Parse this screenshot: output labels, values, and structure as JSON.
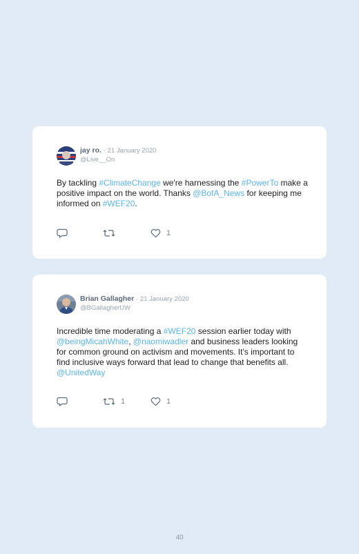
{
  "tweets": [
    {
      "name": "jay ro.",
      "date": "· 21 January 2020",
      "handle": "@Live__On",
      "body": [
        {
          "t": "By tackling ",
          "tag": false
        },
        {
          "t": "#ClimateChange",
          "tag": true
        },
        {
          "t": " we're harnessing the ",
          "tag": false
        },
        {
          "t": "#PowerTo",
          "tag": true
        },
        {
          "t": " make a positive impact on the world. Thanks ",
          "tag": false
        },
        {
          "t": "@BofA_News",
          "tag": true
        },
        {
          "t": " for keeping me informed on ",
          "tag": false
        },
        {
          "t": "#WEF20",
          "tag": true
        },
        {
          "t": ".",
          "tag": false
        }
      ],
      "reply_count": "",
      "retweet_count": "",
      "like_count": "1"
    },
    {
      "name": "Brian Gallagher",
      "date": "· 21 January 2020",
      "handle": "@BGallagherUW",
      "body": [
        {
          "t": "Incredible time moderating a ",
          "tag": false
        },
        {
          "t": "#WEF20",
          "tag": true
        },
        {
          "t": " session earlier today with ",
          "tag": false
        },
        {
          "t": "@beingMicahWhite",
          "tag": true
        },
        {
          "t": ", ",
          "tag": false
        },
        {
          "t": "@naomiwadler",
          "tag": true
        },
        {
          "t": " and business leaders looking for common ground on activism and movements. It's important to find inclusive ways forward that lead to change that benefits all. ",
          "tag": false
        },
        {
          "t": "@UnitedWay",
          "tag": true
        }
      ],
      "reply_count": "",
      "retweet_count": "1",
      "like_count": "1"
    }
  ],
  "icons": {
    "reply": "reply-icon",
    "retweet": "retweet-icon",
    "like": "heart-icon"
  },
  "colors": {
    "background": "#e1ebf5",
    "card": "#ffffff",
    "link": "#5ab4e8",
    "name": "#5a6878",
    "muted": "#9aa4ae"
  },
  "page_number": "40"
}
